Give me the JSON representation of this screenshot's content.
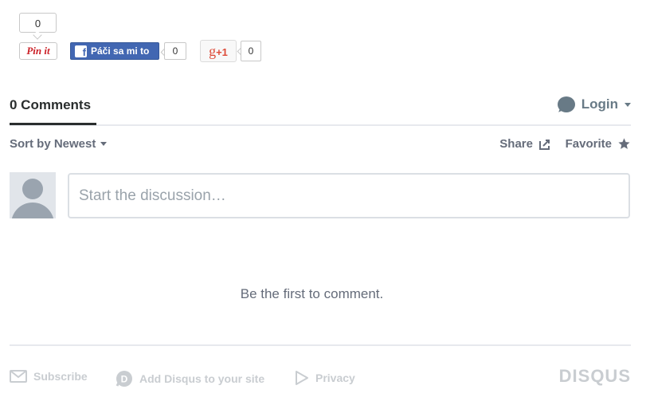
{
  "social": {
    "pin_count": "0",
    "pin_label": "Pin it",
    "fb_icon": "f",
    "fb_label": "Páči sa mi to",
    "fb_count": "0",
    "gplus_label": "g",
    "gplus_plus": "+1",
    "gplus_count": "0"
  },
  "disqus": {
    "comments_tab": "0 Comments",
    "login_label": "Login",
    "sort_label": "Sort by Newest",
    "share_label": "Share",
    "favorite_label": "Favorite",
    "composer_placeholder": "Start the discussion…",
    "empty_message": "Be the first to comment.",
    "footer": {
      "subscribe": "Subscribe",
      "add_disqus": "Add Disqus to your site",
      "privacy": "Privacy",
      "brand": "DISQUS"
    },
    "colors": {
      "text_dark": "#2a2e2e",
      "text_muted": "#656c7a",
      "footer_muted": "#c9cdd1",
      "facebook_blue": "#4267b2",
      "pinterest_red": "#cb2027",
      "gplus_red": "#dd4b39"
    },
    "icons": [
      "chat-bubble-icon",
      "share-arrow-icon",
      "star-icon",
      "envelope-icon",
      "disqus-d-icon",
      "privacy-play-icon"
    ]
  }
}
